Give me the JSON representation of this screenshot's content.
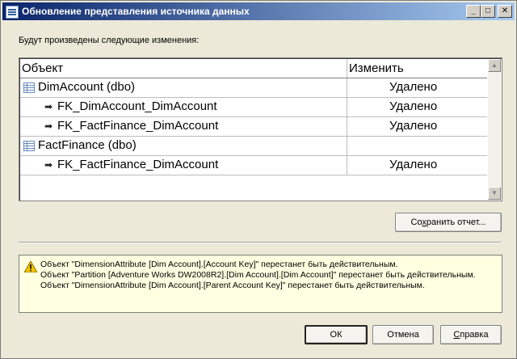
{
  "window": {
    "title": "Обновление представления источника данных",
    "min_glyph": "_",
    "max_glyph": "□",
    "close_glyph": "✕"
  },
  "intro_text": "Будут произведены следующие изменения:",
  "grid": {
    "headers": {
      "object": "Объект",
      "change": "Изменить"
    },
    "rows": [
      {
        "object": "DimAccount (dbo)",
        "change": "Удалено",
        "level": 0
      },
      {
        "object": "FK_DimAccount_DimAccount",
        "change": "Удалено",
        "level": 1
      },
      {
        "object": "FK_FactFinance_DimAccount",
        "change": "Удалено",
        "level": 1
      },
      {
        "object": "FactFinance (dbo)",
        "change": "",
        "level": 0
      },
      {
        "object": "FK_FactFinance_DimAccount",
        "change": "Удалено",
        "level": 1
      }
    ]
  },
  "buttons": {
    "save_report": {
      "pre": "Со",
      "key": "х",
      "post": "ранить отчет..."
    },
    "ok": "ОК",
    "cancel": "Отмена",
    "help": {
      "key": "С",
      "post": "правка"
    }
  },
  "warnings": [
    "Объект \"DimensionAttribute [Dim Account].[Account Key]\" перестанет быть действительным.",
    "Объект \"Partition [Adventure Works DW2008R2].[Dim Account].[Dim Account]\" перестанет быть действительным.",
    "Объект \"DimensionAttribute [Dim Account].[Parent Account Key]\" перестанет быть действительным."
  ],
  "colors": {
    "title_start": "#0a246a",
    "title_end": "#a6caf0",
    "warning_bg": "#ffffe1",
    "warning_icon": "#f5c400"
  }
}
